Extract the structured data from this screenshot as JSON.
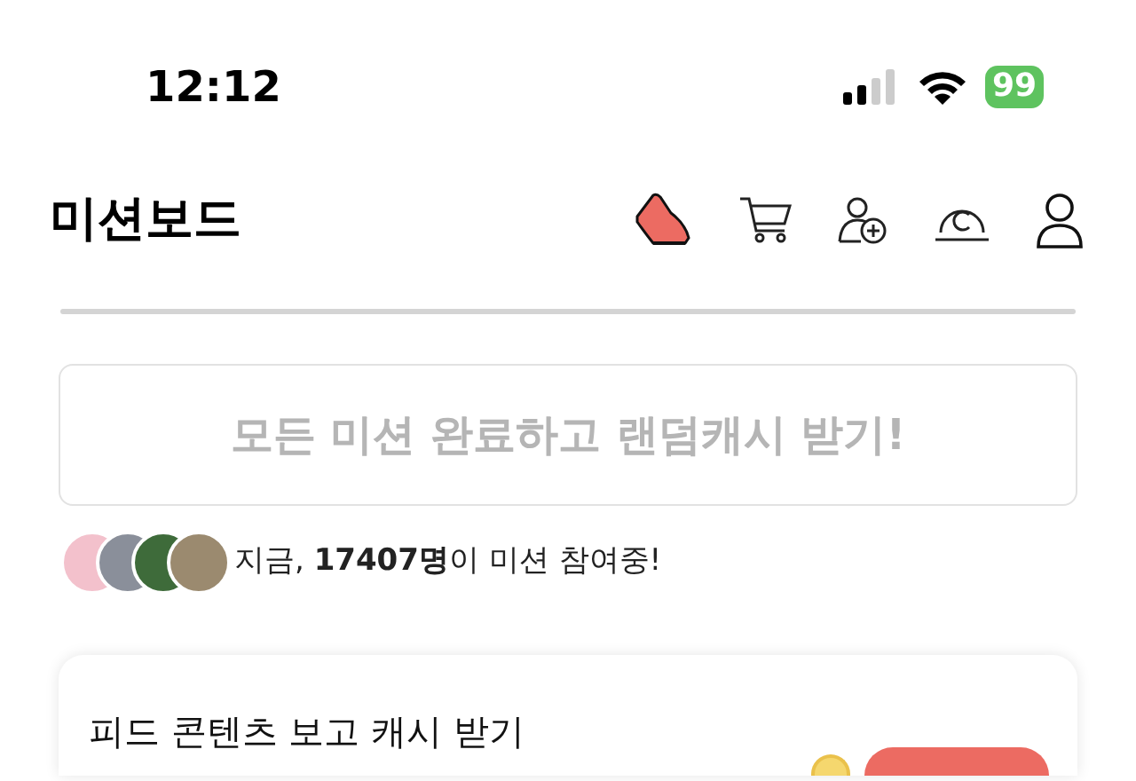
{
  "status_bar": {
    "time": "12:12",
    "battery": "99"
  },
  "header": {
    "title": "미션보드"
  },
  "banner": {
    "text": "모든 미션 완료하고 랜덤캐시 받기!"
  },
  "participants": {
    "text": "지금, **17407명**이 미션 참여중!"
  },
  "mission": {
    "title": "피드 콘텐츠 보고 캐시 받기"
  }
}
